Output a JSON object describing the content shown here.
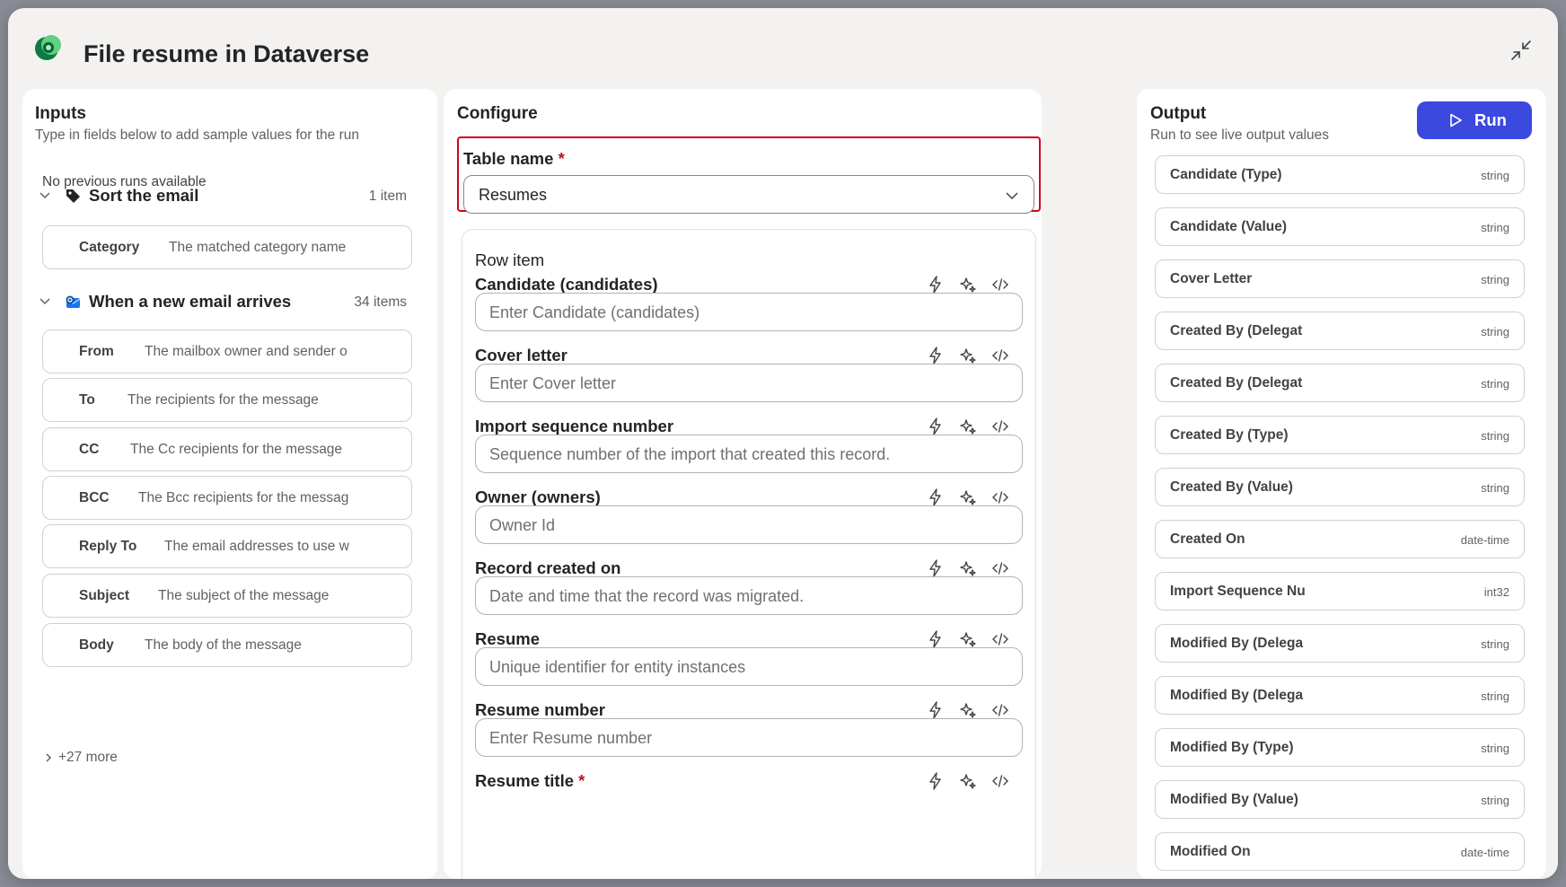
{
  "header": {
    "title": "File resume in Dataverse",
    "icons": {
      "logo": "dataverse-logo",
      "collapse": "collapse-icon"
    }
  },
  "inputs": {
    "title": "Inputs",
    "subtitle": "Type in fields below to add sample values for the run",
    "no_runs": "No previous runs available",
    "sections": [
      {
        "title": "Sort the email",
        "count": "1 item",
        "icon": "tag-icon",
        "fields": [
          {
            "label": "Category",
            "hint": "The matched category name"
          }
        ]
      },
      {
        "title": "When a new email arrives",
        "count": "34 items",
        "icon": "outlook-icon",
        "fields": [
          {
            "label": "From",
            "hint": "The mailbox owner and sender o"
          },
          {
            "label": "To",
            "hint": "The recipients for the message"
          },
          {
            "label": "CC",
            "hint": "The Cc recipients for the message"
          },
          {
            "label": "BCC",
            "hint": "The Bcc recipients for the messag"
          },
          {
            "label": "Reply To",
            "hint": "The email addresses to use w"
          },
          {
            "label": "Subject",
            "hint": "The subject of the message"
          },
          {
            "label": "Body",
            "hint": "The body of the message"
          }
        ]
      }
    ],
    "more": "+27 more"
  },
  "configure": {
    "title": "Configure",
    "table_name_label": "Table name",
    "required_mark": "*",
    "table_name_value": "Resumes",
    "row_item_label": "Row item",
    "fields": [
      {
        "label": "Candidate (candidates)",
        "placeholder": "Enter Candidate (candidates)",
        "required": false
      },
      {
        "label": "Cover letter",
        "placeholder": "Enter Cover letter",
        "required": false
      },
      {
        "label": "Import sequence number",
        "placeholder": "Sequence number of the import that created this record.",
        "required": false
      },
      {
        "label": "Owner (owners)",
        "placeholder": "Owner Id",
        "required": false
      },
      {
        "label": "Record created on",
        "placeholder": "Date and time that the record was migrated.",
        "required": false
      },
      {
        "label": "Resume",
        "placeholder": "Unique identifier for entity instances",
        "required": false
      },
      {
        "label": "Resume number",
        "placeholder": "Enter Resume number",
        "required": false
      },
      {
        "label": "Resume title",
        "placeholder": "",
        "required": true
      }
    ],
    "field_icons": [
      "lightning-icon",
      "sparkle-icon",
      "code-icon"
    ]
  },
  "output": {
    "title": "Output",
    "subtitle": "Run to see live output values",
    "run_label": "Run",
    "rows": [
      {
        "name": "Candidate (Type)",
        "type": "string"
      },
      {
        "name": "Candidate (Value)",
        "type": "string"
      },
      {
        "name": "Cover Letter",
        "type": "string"
      },
      {
        "name": "Created By (Delegat",
        "type": "string"
      },
      {
        "name": "Created By (Delegat",
        "type": "string"
      },
      {
        "name": "Created By (Type)",
        "type": "string"
      },
      {
        "name": "Created By (Value)",
        "type": "string"
      },
      {
        "name": "Created On",
        "type": "date-time"
      },
      {
        "name": "Import Sequence Nu",
        "type": "int32"
      },
      {
        "name": "Modified By (Delega",
        "type": "string"
      },
      {
        "name": "Modified By (Delega",
        "type": "string"
      },
      {
        "name": "Modified By (Type)",
        "type": "string"
      },
      {
        "name": "Modified By (Value)",
        "type": "string"
      },
      {
        "name": "Modified On",
        "type": "date-time"
      }
    ]
  },
  "colors": {
    "accent": "#3b49df",
    "highlight_border": "#d0021b",
    "required": "#c50f1f"
  }
}
